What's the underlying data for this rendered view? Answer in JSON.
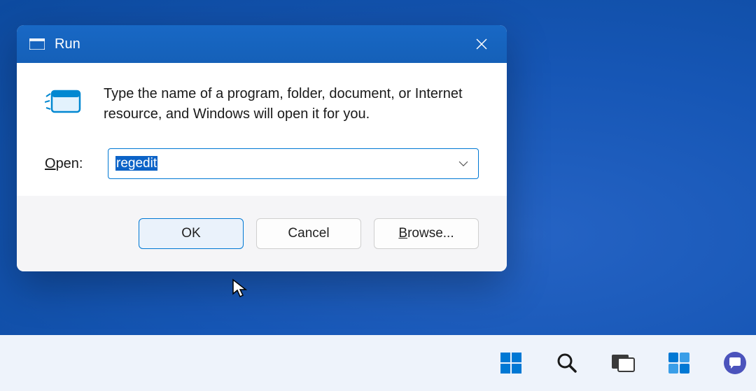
{
  "dialog": {
    "title": "Run",
    "description": "Type the name of a program, folder, document, or Internet resource, and Windows will open it for you.",
    "open_label": "Open:",
    "input_value": "regedit",
    "buttons": {
      "ok": "OK",
      "cancel": "Cancel",
      "browse": "Browse..."
    }
  },
  "taskbar": {
    "items": [
      "start",
      "search",
      "task-view",
      "widgets",
      "chat"
    ]
  }
}
